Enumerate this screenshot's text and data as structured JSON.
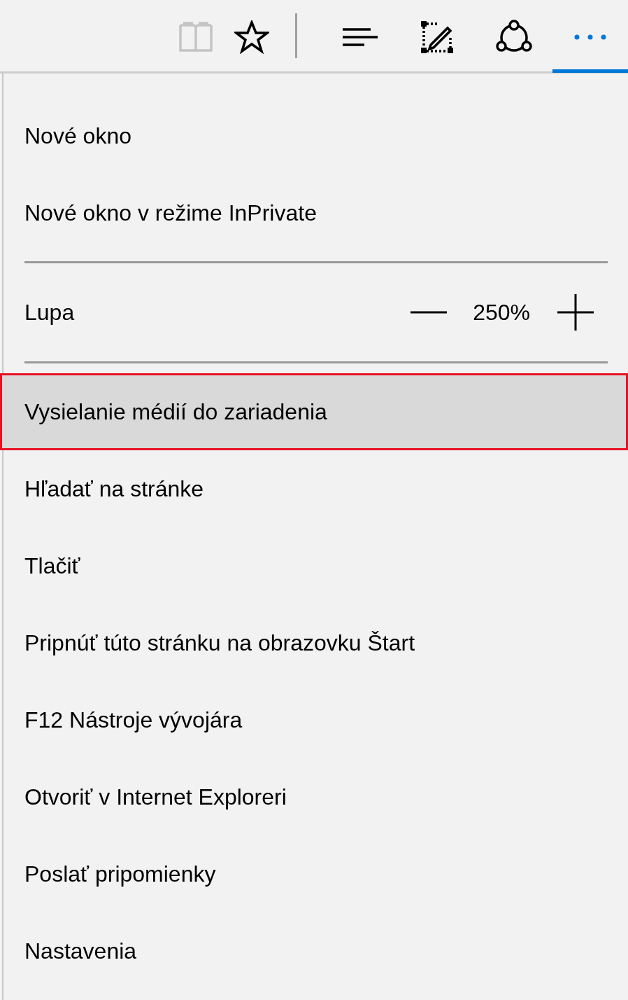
{
  "toolbar": {
    "buttons": [
      {
        "kind": "reading",
        "disabled": true,
        "selected": false
      },
      {
        "kind": "favorite",
        "disabled": false,
        "selected": false
      },
      {
        "kind": "divider"
      },
      {
        "kind": "hub",
        "disabled": false,
        "selected": false
      },
      {
        "kind": "note",
        "disabled": false,
        "selected": false
      },
      {
        "kind": "share",
        "disabled": false,
        "selected": false
      },
      {
        "kind": "more",
        "disabled": false,
        "selected": true
      }
    ]
  },
  "menu": {
    "items": [
      {
        "kind": "item",
        "label": "Nové okno",
        "selected": false
      },
      {
        "kind": "item",
        "label": "Nové okno v režime InPrivate",
        "selected": false
      },
      {
        "kind": "separator"
      },
      {
        "kind": "zoom",
        "label": "Lupa",
        "value": "250%"
      },
      {
        "kind": "separator"
      },
      {
        "kind": "item",
        "label": "Vysielanie médií do zariadenia",
        "selected": true
      },
      {
        "kind": "item",
        "label": "Hľadať na stránke",
        "selected": false
      },
      {
        "kind": "item",
        "label": "Tlačiť",
        "selected": false
      },
      {
        "kind": "item",
        "label": "Pripnúť túto stránku na obrazovku Štart",
        "selected": false
      },
      {
        "kind": "item",
        "label": "F12 Nástroje vývojára",
        "selected": false
      },
      {
        "kind": "item",
        "label": "Otvoriť v Internet Exploreri",
        "selected": false
      },
      {
        "kind": "item",
        "label": "Poslať pripomienky",
        "selected": false
      },
      {
        "kind": "item",
        "label": "Nastavenia",
        "selected": false
      }
    ]
  }
}
